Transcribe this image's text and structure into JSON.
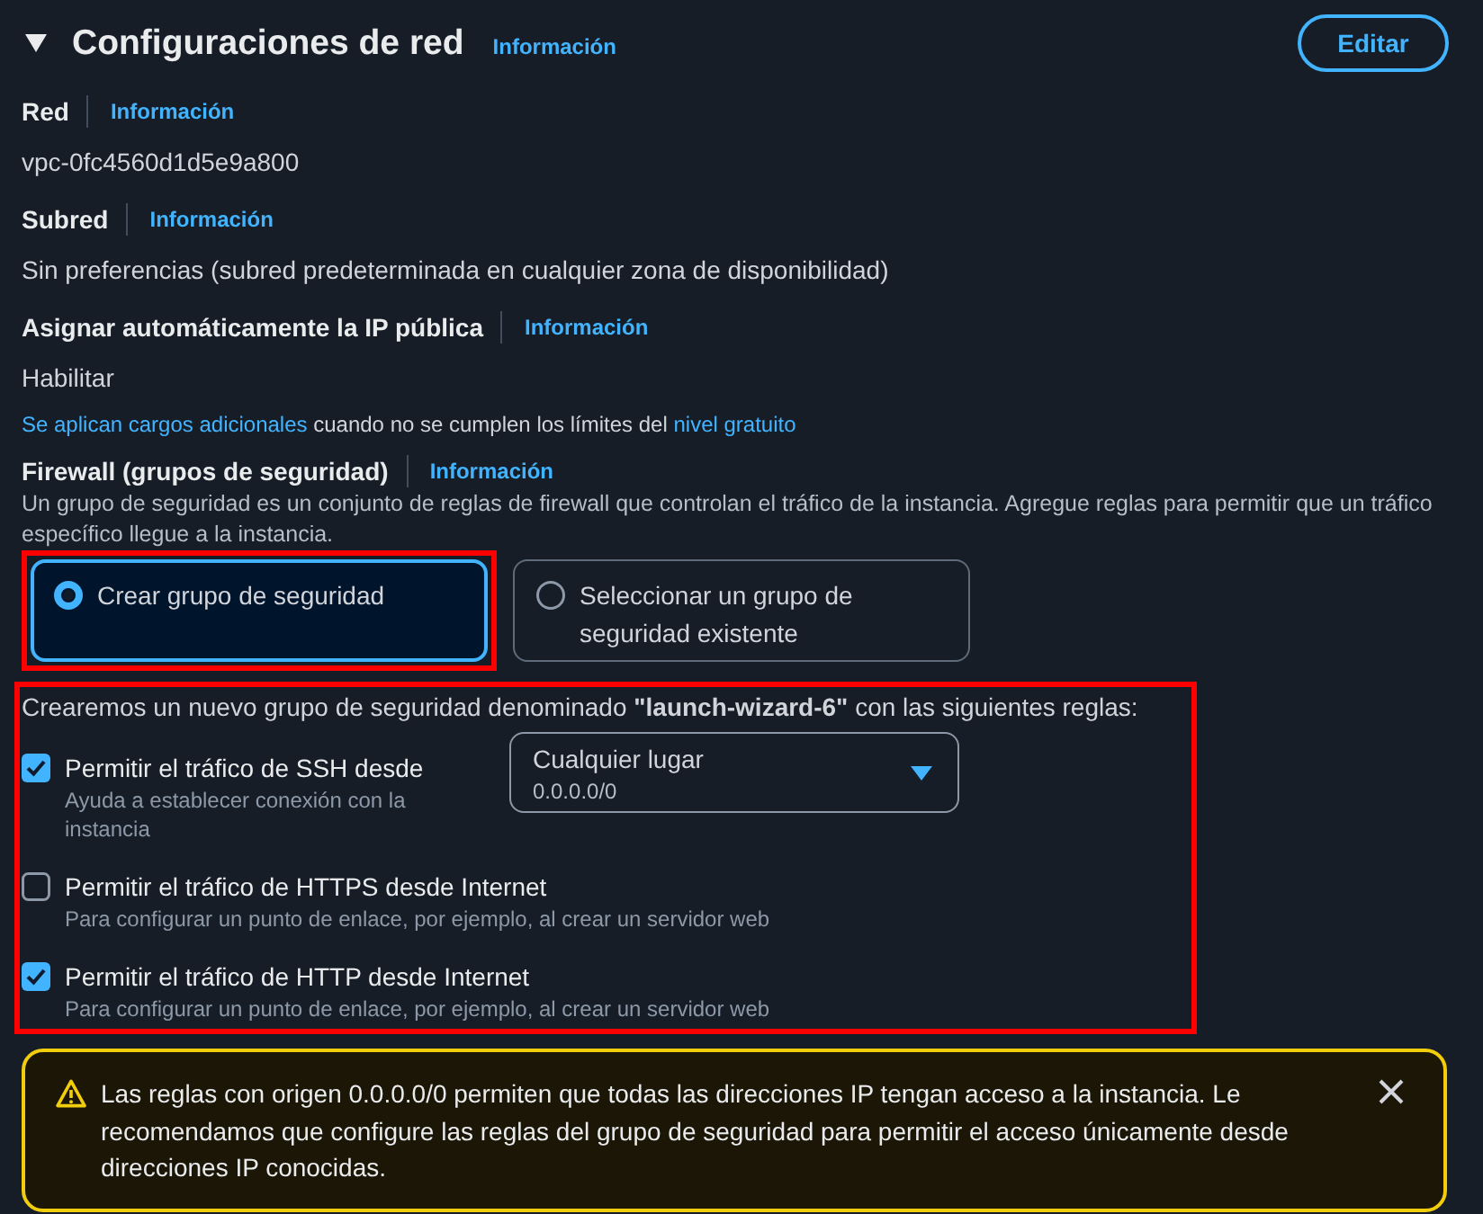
{
  "section": {
    "title": "Configuraciones de red",
    "info_link": "Información",
    "expanded": true,
    "edit_button": "Editar"
  },
  "fields": [
    {
      "label": "Red",
      "info_link": "Información",
      "value": "vpc-0fc4560d1d5e9a800"
    },
    {
      "label": "Subred",
      "info_link": "Información",
      "value": "Sin preferencias (subred predeterminada en cualquier zona de disponibilidad)"
    },
    {
      "label": "Asignar automáticamente la IP pública",
      "info_link": "Información",
      "value": "Habilitar"
    }
  ],
  "pricing_note": [
    {
      "kind": "link",
      "text": "Se aplican cargos adicionales"
    },
    {
      "kind": "text",
      "text": "cuando no se cumplen los límites del"
    },
    {
      "kind": "link",
      "text": "nivel gratuito"
    }
  ],
  "firewall": {
    "label": "Firewall (grupos de seguridad)",
    "info_link": "Información",
    "description": "Un grupo de seguridad es un conjunto de reglas de firewall que controlan el tráfico de la instancia. Agregue reglas para permitir que un tráfico específico llegue a la instancia.",
    "options": [
      {
        "label": "Crear grupo de seguridad",
        "selected": true,
        "annotated": true
      },
      {
        "label": "Seleccionar un grupo de seguridad existente",
        "selected": false,
        "annotated": false
      }
    ]
  },
  "rules": {
    "annotated": true,
    "intro": "Crearemos un nuevo grupo de seguridad denominado **\"launch-wizard-6\"** con las siguientes reglas:",
    "items": [
      {
        "label": "Permitir el tráfico de SSH desde",
        "hint": "Ayuda a establecer conexión con la instancia",
        "checked": true,
        "source": {
          "value": "Cualquier lugar",
          "detail": "0.0.0.0/0"
        }
      },
      {
        "label": "Permitir el tráfico de HTTPS desde Internet",
        "hint": "Para configurar un punto de enlace, por ejemplo, al crear un servidor web",
        "checked": false
      },
      {
        "label": "Permitir el tráfico de HTTP desde Internet",
        "hint": "Para configurar un punto de enlace, por ejemplo, al crear un servidor web",
        "checked": true
      }
    ]
  },
  "warning": {
    "text": "Las reglas con origen 0.0.0.0/0 permiten que todas las direcciones IP tengan acceso a la instancia. Le recomendamos que configure las reglas del grupo de seguridad para permitir el acceso únicamente desde direcciones IP conocidas."
  }
}
